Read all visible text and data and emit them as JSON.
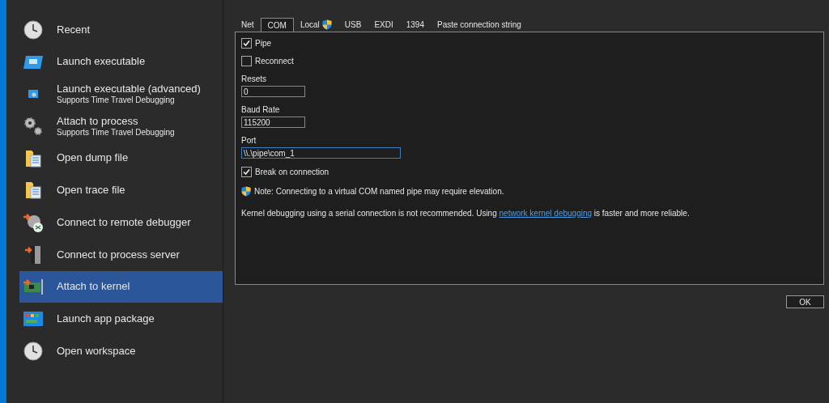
{
  "sidebar": {
    "items": [
      {
        "label": "Recent",
        "selected": false
      },
      {
        "label": "Launch executable",
        "selected": false
      },
      {
        "label": "Launch executable (advanced)",
        "subtitle": "Supports Time Travel Debugging",
        "selected": false
      },
      {
        "label": "Attach to process",
        "subtitle": "Supports Time Travel Debugging",
        "selected": false
      },
      {
        "label": "Open dump file",
        "selected": false
      },
      {
        "label": "Open trace file",
        "selected": false
      },
      {
        "label": "Connect to remote debugger",
        "selected": false
      },
      {
        "label": "Connect to process server",
        "selected": false
      },
      {
        "label": "Attach to kernel",
        "selected": true
      },
      {
        "label": "Launch app package",
        "selected": false
      },
      {
        "label": "Open workspace",
        "selected": false
      }
    ]
  },
  "tabs": [
    {
      "label": "Net",
      "selected": false
    },
    {
      "label": "COM",
      "selected": true
    },
    {
      "label": "Local",
      "shield": true,
      "selected": false
    },
    {
      "label": "USB",
      "selected": false
    },
    {
      "label": "EXDI",
      "selected": false
    },
    {
      "label": "1394",
      "selected": false
    },
    {
      "label": "Paste connection string",
      "selected": false
    }
  ],
  "com_panel": {
    "pipe": {
      "label": "Pipe",
      "checked": true
    },
    "reconnect": {
      "label": "Reconnect",
      "checked": false
    },
    "fields": [
      {
        "label": "Resets",
        "value": "0",
        "focused": false,
        "wide": false
      },
      {
        "label": "Baud Rate",
        "value": "115200",
        "focused": false,
        "wide": false
      },
      {
        "label": "Port",
        "value": "\\\\.\\pipe\\com_1",
        "focused": true,
        "wide": true
      }
    ],
    "break_on_connection": {
      "label": "Break on connection",
      "checked": true
    },
    "note": "Note: Connecting to a virtual COM named pipe may require elevation.",
    "warning": {
      "before": "Kernel debugging using a serial connection is not recommended. Using ",
      "link": "network kernel debugging",
      "after": " is faster and more reliable."
    }
  },
  "buttons": [
    "OK"
  ]
}
